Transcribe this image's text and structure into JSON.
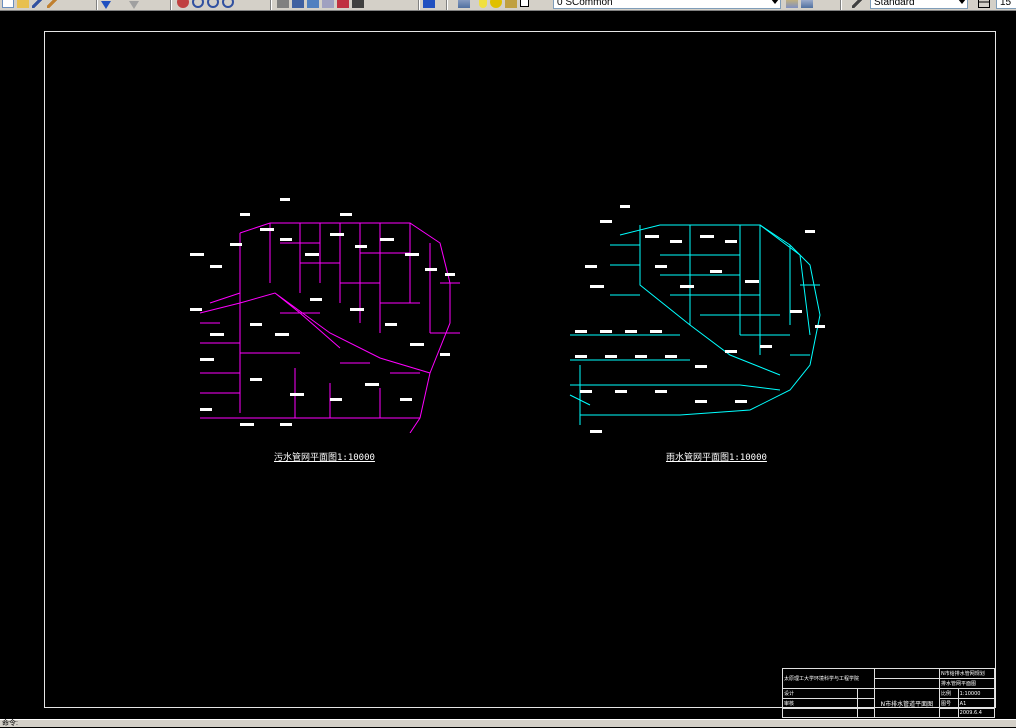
{
  "toolbar": {
    "layer_value": "0 SCommon",
    "textstyle_value": "Standard",
    "right_value": "15",
    "icons": [
      "new-icon",
      "open-icon",
      "pencil-icon",
      "brush-icon",
      "down-arrow-icon",
      "arrow-icon",
      "down-arrow-icon",
      "pan-icon",
      "zoom-realtime-icon",
      "zoom-window-icon",
      "zoom-previous-icon",
      "properties-icon",
      "design-center-icon",
      "tool-palette-icon",
      "sheet-set-icon",
      "markup-icon",
      "calculator-icon",
      "help-icon",
      "layers-icon",
      "bulb-icon",
      "sun-icon",
      "lock-icon",
      "color-icon",
      "layer-state-icon",
      "layer-prev-icon",
      "text-style-icon",
      "dim-style-icon"
    ]
  },
  "drawing": {
    "left_plan_caption": "污水管网平面图1:10000",
    "right_plan_caption": "雨水管网平面图1:10000",
    "left_pipe_color": "#ff00ff",
    "right_pipe_color": "#00ffff"
  },
  "titleblock": {
    "school": "太原理工大学环境科学与工程学院",
    "drawing_title": "N市给排水管网规划",
    "subtitle": "排水管网平面图",
    "design": "设计",
    "check": "审核",
    "scale_label": "比例",
    "scale": "1:10000",
    "sheet_label": "图号",
    "sheet": "A1",
    "drawing_name": "N市排水管道平面图",
    "date": "2009.6.4"
  },
  "status": {
    "text": "命令:"
  }
}
